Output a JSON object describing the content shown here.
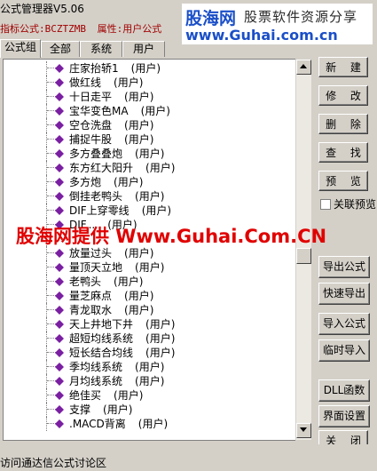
{
  "window": {
    "title": "公式管理器V5.06"
  },
  "watermark": {
    "brand": "股海网",
    "slogan": "股票软件资源分享",
    "url": "www.Guhai.com.cn"
  },
  "indicator": {
    "formula_label": "指标公式:",
    "formula_value": "BCZTZMB",
    "property_label": "属性:",
    "property_value": "用户公式"
  },
  "tabs": [
    {
      "label": "公式组"
    },
    {
      "label": "全部"
    },
    {
      "label": "系统"
    },
    {
      "label": "用户"
    }
  ],
  "tree": {
    "items": [
      {
        "name": "庄家抬轿1",
        "owner": "(用户)"
      },
      {
        "name": "做红线",
        "owner": "(用户)"
      },
      {
        "name": "十日走平",
        "owner": "(用户)"
      },
      {
        "name": "宝华变色MA",
        "owner": "(用户)"
      },
      {
        "name": "空仓洗盘",
        "owner": "(用户)"
      },
      {
        "name": "捕捉牛股",
        "owner": "(用户)"
      },
      {
        "name": "多方叠叠炮",
        "owner": "(用户)"
      },
      {
        "name": "东方红大阳升",
        "owner": "(用户)"
      },
      {
        "name": "多方炮",
        "owner": "(用户)"
      },
      {
        "name": "倒挂老鸭头",
        "owner": "(用户)"
      },
      {
        "name": "DIF上穿零线",
        "owner": "(用户)"
      },
      {
        "name": "DIF...",
        "owner": "(用户)"
      },
      {
        "name": "",
        "owner": ""
      },
      {
        "name": "放量过头",
        "owner": "(用户)"
      },
      {
        "name": "量顶天立地",
        "owner": "(用户)"
      },
      {
        "name": "老鸭头",
        "owner": "(用户)"
      },
      {
        "name": "量芝麻点",
        "owner": "(用户)"
      },
      {
        "name": "青龙取水",
        "owner": "(用户)"
      },
      {
        "name": "天上井地下井",
        "owner": "(用户)"
      },
      {
        "name": "超短均线系统",
        "owner": "(用户)"
      },
      {
        "name": "短长结合均线",
        "owner": "(用户)"
      },
      {
        "name": "季均线系统",
        "owner": "(用户)"
      },
      {
        "name": "月均线系统",
        "owner": "(用户)"
      },
      {
        "name": "绝佳买",
        "owner": "(用户)"
      },
      {
        "name": "支撑",
        "owner": "(用户)"
      },
      {
        "name": ".MACD背离",
        "owner": "(用户)"
      }
    ]
  },
  "buttons": {
    "new": "新 建",
    "edit": "修 改",
    "delete": "删 除",
    "find": "查 找",
    "preview": "预 览",
    "link_preview": "关联预览",
    "export": "导出公式",
    "quick_export": "快速导出",
    "import": "导入公式",
    "temp_import": "临时导入",
    "dll": "DLL函数",
    "ui_settings": "界面设置",
    "close": "关 闭"
  },
  "overlay": {
    "text": "股海网提供 Www.Guhai.Com.CN"
  },
  "status": {
    "text": "访问通达信公式讨论区"
  },
  "colors": {
    "formula_icon": "#7a1fa2",
    "ad_red": "#e00000",
    "brand_blue": "#1a4fc8"
  },
  "icons": {
    "tree_item": "formula-diamond-icon",
    "scroll_up": "arrow-up-icon",
    "scroll_down": "arrow-down-icon"
  }
}
